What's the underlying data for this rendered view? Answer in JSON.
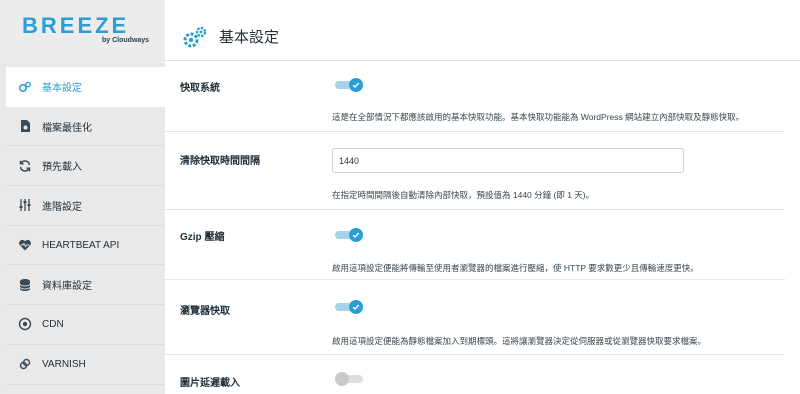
{
  "brand": {
    "name": "BREEZE",
    "sub": "by Cloudways"
  },
  "sidebar": {
    "items": [
      {
        "label": "基本設定",
        "icon": "gears-icon",
        "active": true
      },
      {
        "label": "檔案最佳化",
        "icon": "file-gear-icon",
        "active": false
      },
      {
        "label": "預先載入",
        "icon": "sync-icon",
        "active": false
      },
      {
        "label": "進階設定",
        "icon": "sliders-icon",
        "active": false
      },
      {
        "label": "HEARTBEAT API",
        "icon": "heart-pulse-icon",
        "active": false
      },
      {
        "label": "資料庫設定",
        "icon": "database-icon",
        "active": false
      },
      {
        "label": "CDN",
        "icon": "globe-icon",
        "active": false
      },
      {
        "label": "VARNISH",
        "icon": "link-icon",
        "active": false
      }
    ]
  },
  "header": {
    "title": "基本設定"
  },
  "settings": {
    "cache_system": {
      "label": "快取系統",
      "enabled": true,
      "desc": "這是在全部情況下都應該啟用的基本快取功能。基本快取功能能為 WordPress 網站建立內部快取及靜態快取。"
    },
    "purge_interval": {
      "label": "清除快取時間間隔",
      "value": "1440",
      "desc": "在指定時間間隔後自動清除內部快取，預設值為 1440 分鐘 (即 1 天)。"
    },
    "gzip": {
      "label": "Gzip 壓縮",
      "enabled": true,
      "desc": "啟用這項設定便能將傳輸至使用者瀏覽器的檔案進行壓縮，使 HTTP 要求數更少且傳輸速度更快。"
    },
    "browser_cache": {
      "label": "瀏覽器快取",
      "enabled": true,
      "desc": "啟用這項設定便能為靜態檔案加入到期標頭。這將讓瀏覽器決定從伺服器或從瀏覽器快取要求檔案。"
    },
    "lazy_load": {
      "label": "圖片延遲載入",
      "enabled": false
    }
  },
  "colors": {
    "accent": "#2a9fd6",
    "text": "#22303a"
  }
}
